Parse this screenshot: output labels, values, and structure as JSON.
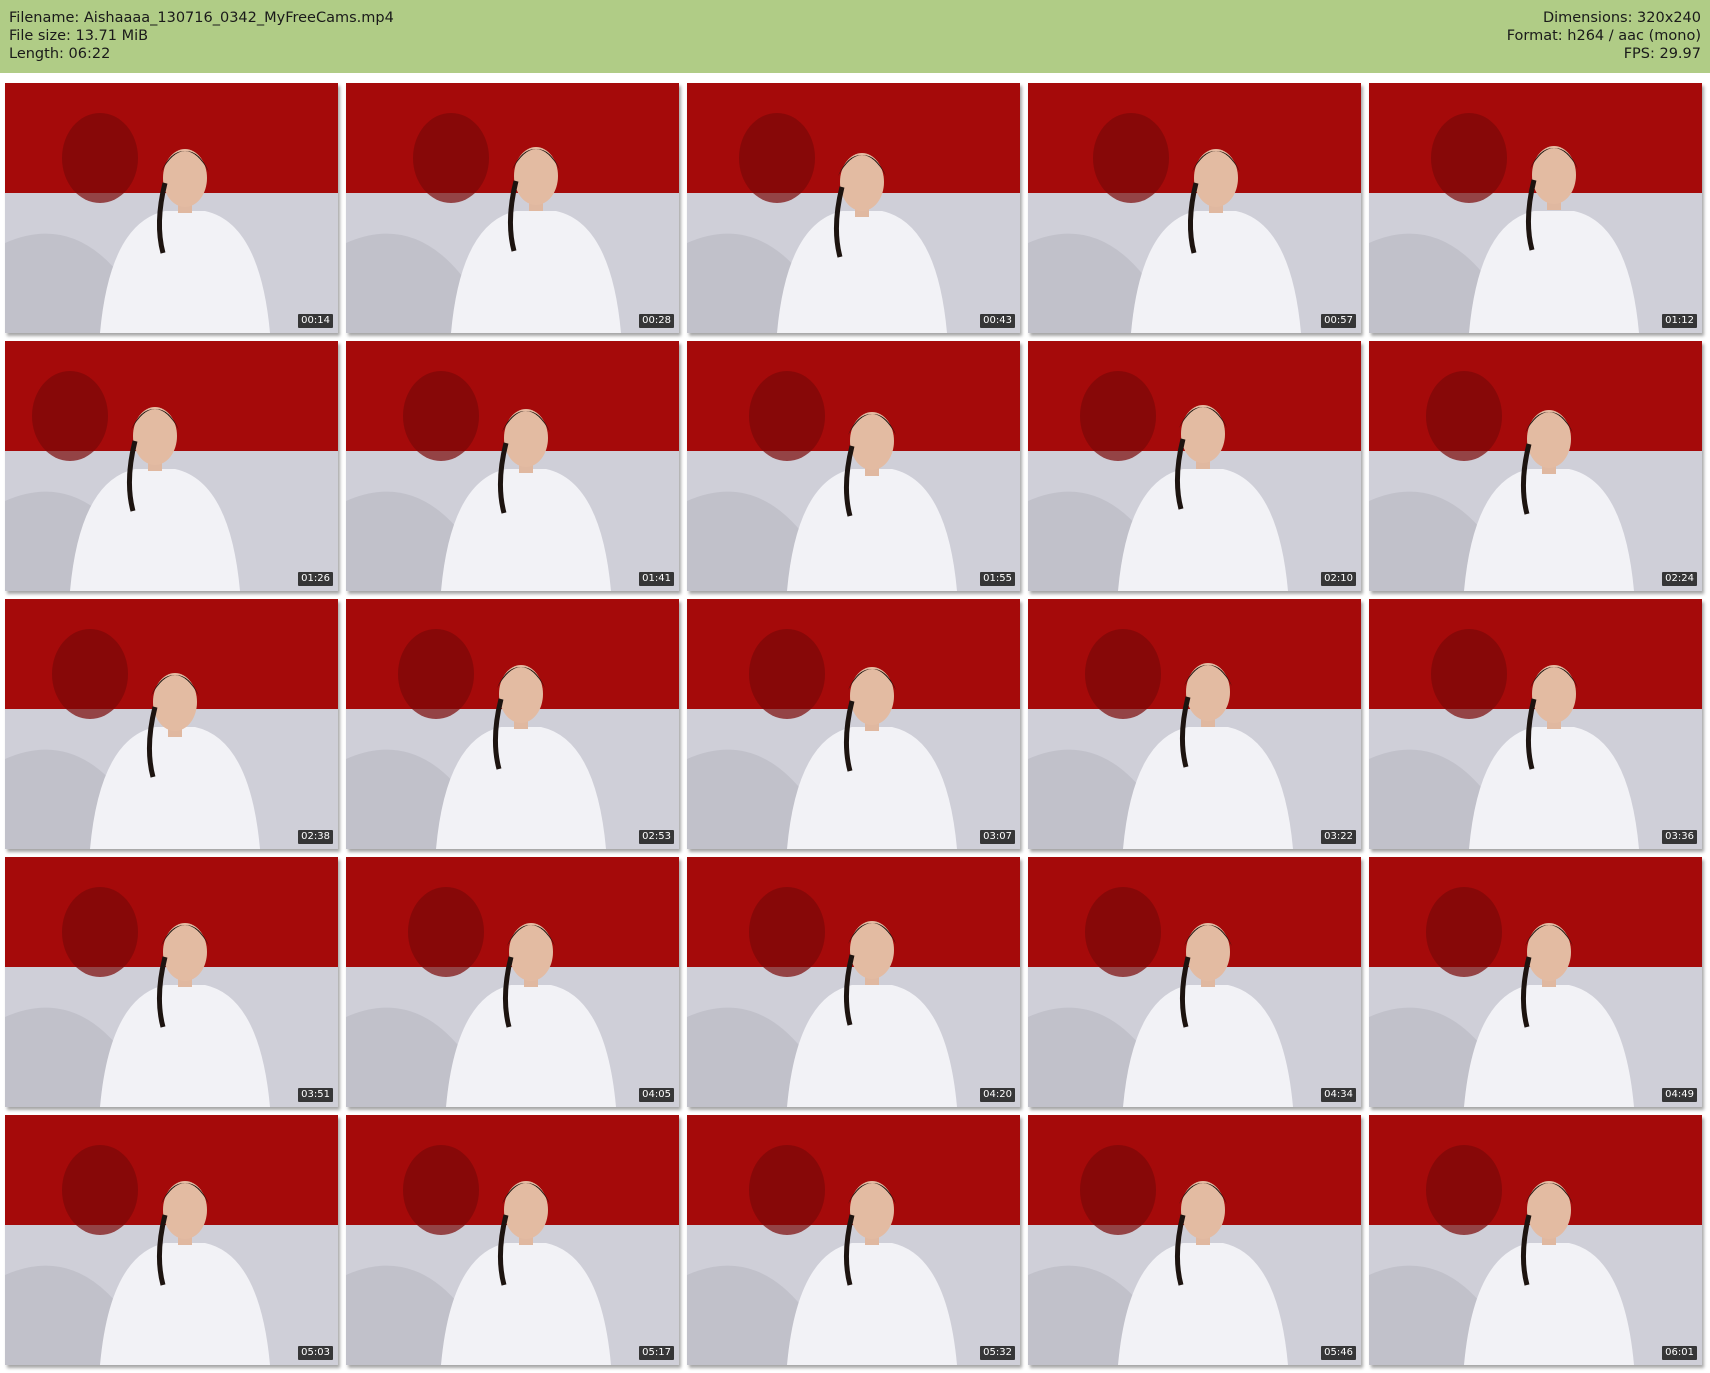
{
  "header": {
    "filename": "Filename: Aishaaaa_130716_0342_MyFreeCams.mp4",
    "filesize": "File size: 13.71 MiB",
    "length": "Length: 06:22",
    "dimensions": "Dimensions: 320x240",
    "format": "Format: h264 / aac (mono)",
    "fps": "FPS: 29.97"
  },
  "colors": {
    "header_bg": "#b0cc86",
    "wall_red": "#a50a0a",
    "headboard_grey": "#cfcfd8",
    "shirt_white": "#f2f2f6"
  },
  "thumbnails": [
    {
      "time": "00:14"
    },
    {
      "time": "00:28"
    },
    {
      "time": "00:43"
    },
    {
      "time": "00:57"
    },
    {
      "time": "01:12"
    },
    {
      "time": "01:26"
    },
    {
      "time": "01:41"
    },
    {
      "time": "01:55"
    },
    {
      "time": "02:10"
    },
    {
      "time": "02:24"
    },
    {
      "time": "02:38"
    },
    {
      "time": "02:53"
    },
    {
      "time": "03:07"
    },
    {
      "time": "03:22"
    },
    {
      "time": "03:36"
    },
    {
      "time": "03:51"
    },
    {
      "time": "04:05"
    },
    {
      "time": "04:20"
    },
    {
      "time": "04:34"
    },
    {
      "time": "04:49"
    },
    {
      "time": "05:03"
    },
    {
      "time": "05:17"
    },
    {
      "time": "05:32"
    },
    {
      "time": "05:46"
    },
    {
      "time": "06:01"
    }
  ]
}
